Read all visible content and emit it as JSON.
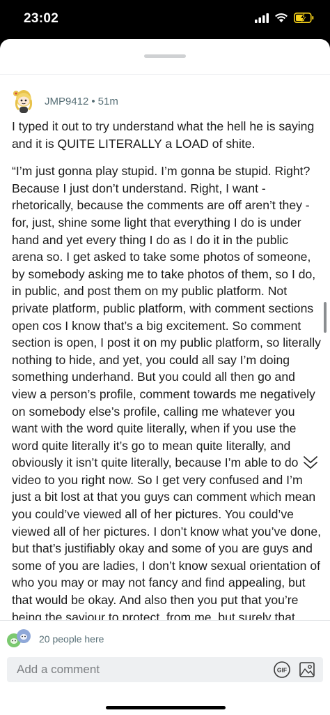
{
  "status_bar": {
    "time": "23:02"
  },
  "comment": {
    "username": "JMP9412",
    "separator": "•",
    "timestamp": "51m",
    "paragraphs": [
      "I typed it out to try understand what the hell he is saying and it is QUITE LITERALLY a LOAD of shite.",
      "“I’m just gonna play stupid. I’m gonna be stupid. Right? Because I just don’t understand. Right, I want - rhetorically, because the comments are off aren’t they - for, just, shine some light that everything I do is under hand and yet every thing I do as I do it in the public arena so. I get asked to take some photos of someone, by somebody asking me to take photos of them, so I do, in public, and post them on my public platform. Not private platform, public platform, with comment sections open cos I know that’s a big excitement. So comment section is open, I post it on my public platform, so literally nothing to hide, and yet, you could all say I’m doing something underhand. But you could all then go and view a person’s profile, comment towards me negatively on somebody else’s profile, calling me whatever you want with the word quite literally, when if you use the word quite literally it’s go to mean quite literally, and obviously it isn’t quite literally, because I’m able to do this video to you right now. So I get very confused and I’m just a bit lost at that you guys can comment which mean you could’ve viewed all of her pictures. You could’ve viewed all of her pictures. I don’t know what you’ve done, but that’s justifiably okay and some of you are guys and some of you are ladies, I don’t know sexual orientation of who you may or may not fancy and find appealing, but that would be okay. And also then you put that you’re being the saviour to protect, from me, but surely that could also mean that some of you might be trying to manipulate a situation to get your own benefit out of it, because, again, you would be strangers on the internet to this person and to me. I wouldn’t know who you were, but if you tried to befriend somebody or message"
    ]
  },
  "presence": {
    "count_text": "20 people here"
  },
  "comment_box": {
    "placeholder": "Add a comment",
    "gif_label": "GIF"
  },
  "icons": [
    "signal-icon",
    "wifi-icon",
    "battery-charging-icon",
    "snoo-avatar-icon",
    "collapse-chevron-icon",
    "gif-icon",
    "image-icon"
  ],
  "colors": {
    "meta_text": "#576f76",
    "input_bg": "#eef0f2",
    "battery": "#f7d21a"
  }
}
